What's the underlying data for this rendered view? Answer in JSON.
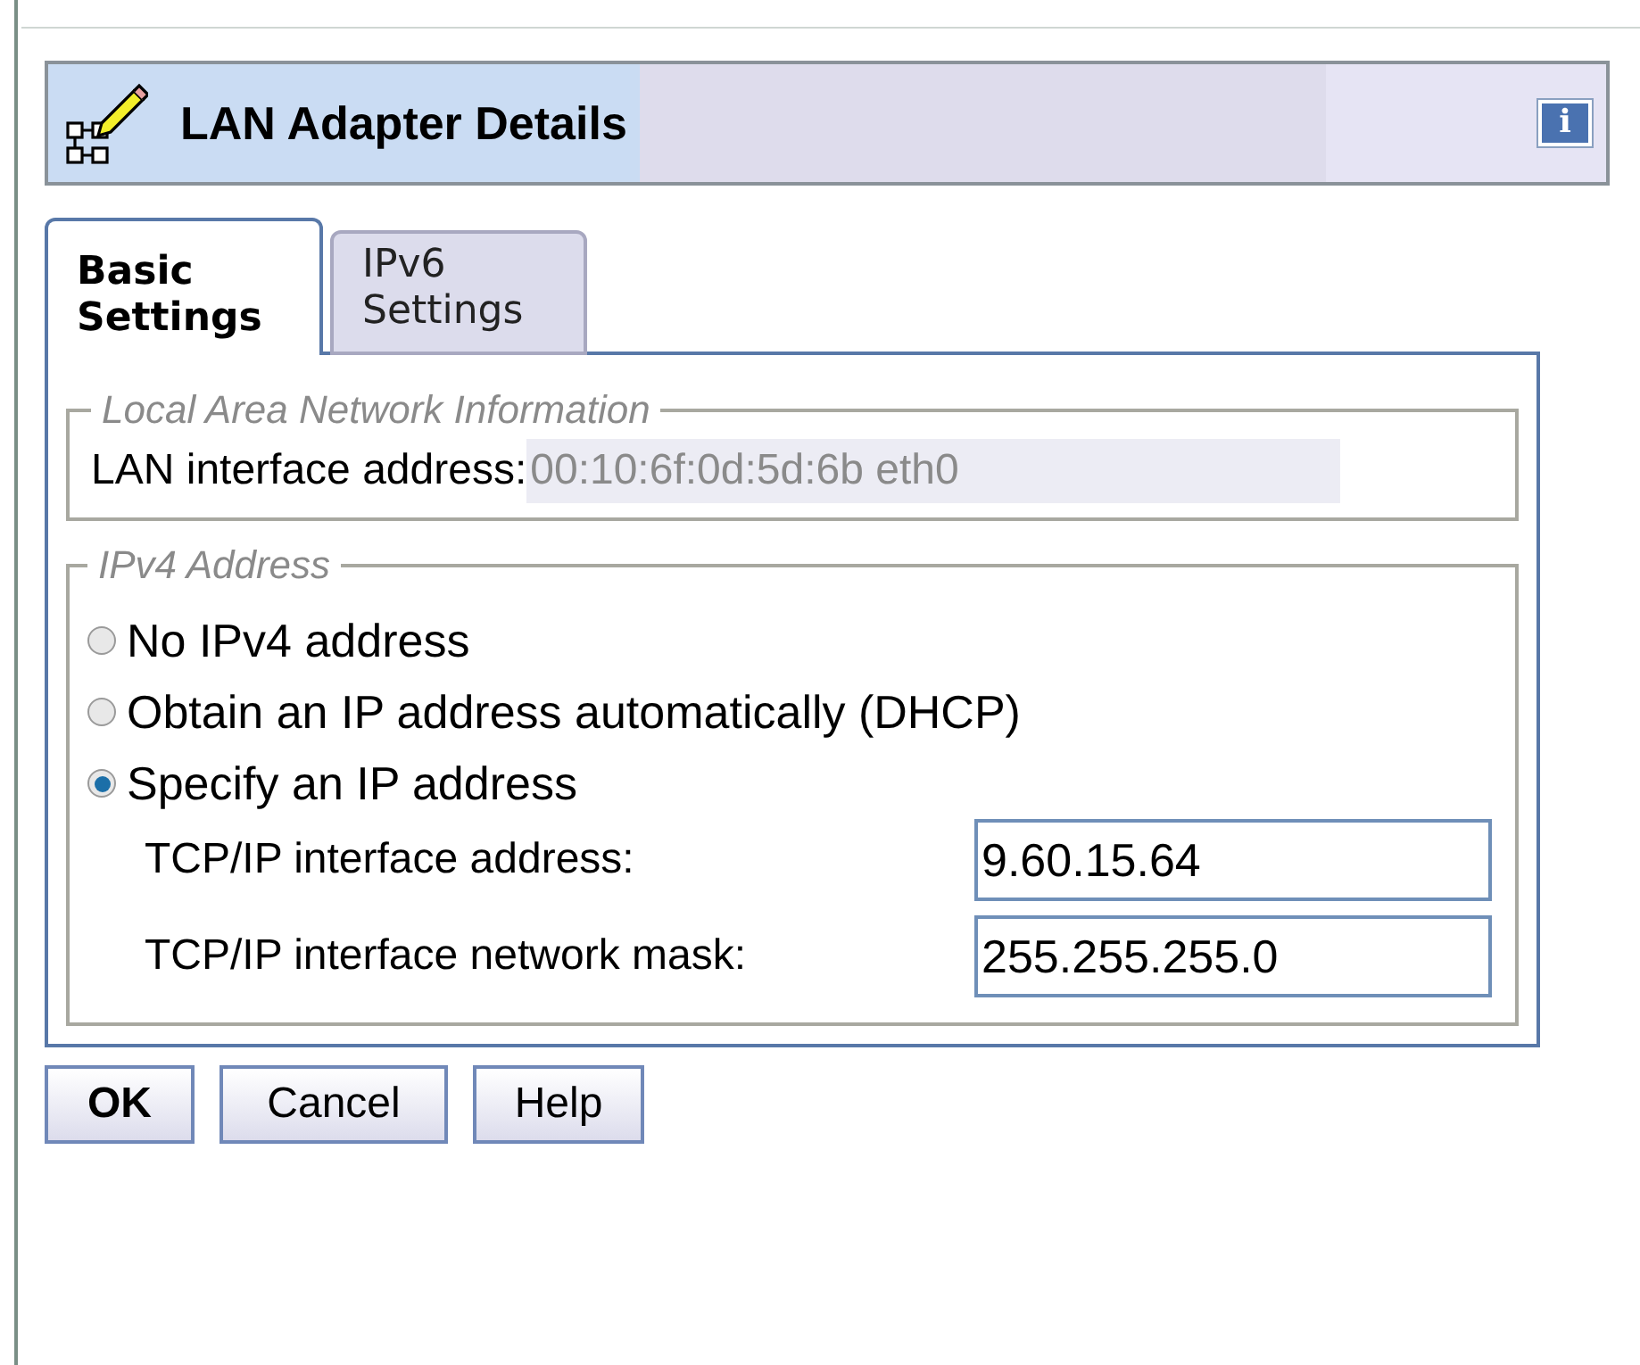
{
  "header": {
    "title": "LAN Adapter Details",
    "info_button": "i"
  },
  "tabs": [
    {
      "label": "Basic Settings",
      "selected": true
    },
    {
      "label": "IPv6 Settings",
      "selected": false
    }
  ],
  "lan_section": {
    "legend": "Local Area Network Information",
    "label": "LAN interface address:",
    "value": "00:10:6f:0d:5d:6b eth0"
  },
  "ipv4_section": {
    "legend": "IPv4 Address",
    "options": [
      {
        "label": "No IPv4 address",
        "selected": false
      },
      {
        "label": "Obtain an IP address automatically (DHCP)",
        "selected": false
      },
      {
        "label": "Specify an IP address",
        "selected": true
      }
    ],
    "fields": [
      {
        "label": "TCP/IP interface address:",
        "value": "9.60.15.64"
      },
      {
        "label": "TCP/IP interface network mask:",
        "value": "255.255.255.0"
      }
    ]
  },
  "buttons": [
    "OK",
    "Cancel",
    "Help"
  ]
}
